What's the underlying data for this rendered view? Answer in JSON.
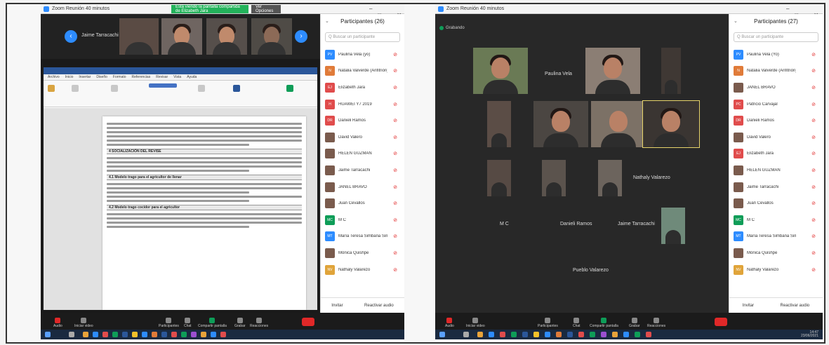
{
  "left": {
    "title": "Zoom Reunión 40 minutos",
    "share_banner": "Está viendo la pantalla compartida de Elizabeth Jara",
    "view_options": "Ver Opciones",
    "thumb_name": "Jaime Tarracachi",
    "doc": {
      "tabs": [
        "Archivo",
        "Inicio",
        "Insertar",
        "Diseño",
        "Formato",
        "Referencias",
        "Revisar",
        "Vista",
        "Ayuda"
      ],
      "section_1": "4   SOCIALIZACIÓN DEL REVISE",
      "section_2": "4.1   Modelo trago para el agricultor de llenar",
      "section_3": "4.2   Modelo trago cocidor para el agricultor"
    },
    "participants_title": "Participantes (26)",
    "search_placeholder": "Q Buscar un participante",
    "participants": [
      {
        "initials": "PV",
        "name": "Paulina Vela (yo)",
        "color": "#2d8cff"
      },
      {
        "initials": "N",
        "name": "Natalia Valverde (Anfitrión)",
        "color": "#e07b39"
      },
      {
        "initials": "EJ",
        "name": "Elizabeth Jara",
        "color": "#e04c4c"
      },
      {
        "initials": "H",
        "name": "HUAWEI Y7 2019",
        "color": "#e04c4c"
      },
      {
        "initials": "DR",
        "name": "Danieli Ramos",
        "color": "#e04c4c"
      },
      {
        "initials": "",
        "name": "David Valero",
        "color": ""
      },
      {
        "initials": "",
        "name": "HELEN GUZMAN",
        "color": ""
      },
      {
        "initials": "",
        "name": "Jaime Tarracachi",
        "color": ""
      },
      {
        "initials": "",
        "name": "JANEL BRAVO",
        "color": ""
      },
      {
        "initials": "",
        "name": "Juan Cevallos",
        "color": ""
      },
      {
        "initials": "MC",
        "name": "M C",
        "color": "#0e9d58"
      },
      {
        "initials": "MT",
        "name": "María Teresa Simbaña Simbaña",
        "color": "#2d8cff"
      },
      {
        "initials": "",
        "name": "Mónica Quishpe",
        "color": ""
      },
      {
        "initials": "NV",
        "name": "Nathaly Valarezo",
        "color": "#e0a43a"
      }
    ],
    "foot_invite": "Invitar",
    "foot_mute": "Reactivar audio",
    "toolbar": [
      "Audio",
      "Iniciar video",
      "Participantes",
      "Chat",
      "Compartir pantalla",
      "Grabar",
      "Reacciones"
    ]
  },
  "right": {
    "title": "Zoom Reunión 40 minutos",
    "rec_label": "Grabando",
    "participants_title": "Participantes (27)",
    "search_placeholder": "Q Buscar un participante",
    "participants": [
      {
        "initials": "PV",
        "name": "Paulina Vela (Yo)",
        "color": "#2d8cff"
      },
      {
        "initials": "N",
        "name": "Natalia Valverde (Anfitrión)",
        "color": "#e07b39"
      },
      {
        "initials": "",
        "name": "JANEL BRAVO",
        "color": ""
      },
      {
        "initials": "PC",
        "name": "Patricio Carvajal",
        "color": "#e04c4c"
      },
      {
        "initials": "DR",
        "name": "Danieli Ramos",
        "color": "#e04c4c"
      },
      {
        "initials": "",
        "name": "David Valero",
        "color": ""
      },
      {
        "initials": "EJ",
        "name": "Elizabeth Jara",
        "color": "#e04c4c"
      },
      {
        "initials": "",
        "name": "HELEN GUZMAN",
        "color": ""
      },
      {
        "initials": "",
        "name": "Jaime Tarracachi",
        "color": ""
      },
      {
        "initials": "",
        "name": "Juan Cevallos",
        "color": ""
      },
      {
        "initials": "MC",
        "name": "M C",
        "color": "#0e9d58"
      },
      {
        "initials": "MT",
        "name": "María Teresa Simbaña Simbaña",
        "color": "#2d8cff"
      },
      {
        "initials": "",
        "name": "Mónica Quishpe",
        "color": ""
      },
      {
        "initials": "NV",
        "name": "Nathaly Valarezo",
        "color": "#e0a43a"
      }
    ],
    "foot_invite": "Invitar",
    "foot_mute": "Reactivar audio",
    "tiles": [
      {
        "name": "Paulina Vela"
      },
      {
        "name": "Nathaly Valarezo"
      },
      {
        "name": "M C"
      },
      {
        "name": "Danieli Ramos"
      },
      {
        "name": "Jaime Tarracachi"
      },
      {
        "name": "Pueblo Valarezo"
      }
    ],
    "toolbar": [
      "Audio",
      "Iniciar video",
      "Participantes",
      "Chat",
      "Compartir pantalla",
      "Grabar",
      "Reacciones"
    ],
    "clock": "14:47",
    "date": "23/06/2021"
  }
}
